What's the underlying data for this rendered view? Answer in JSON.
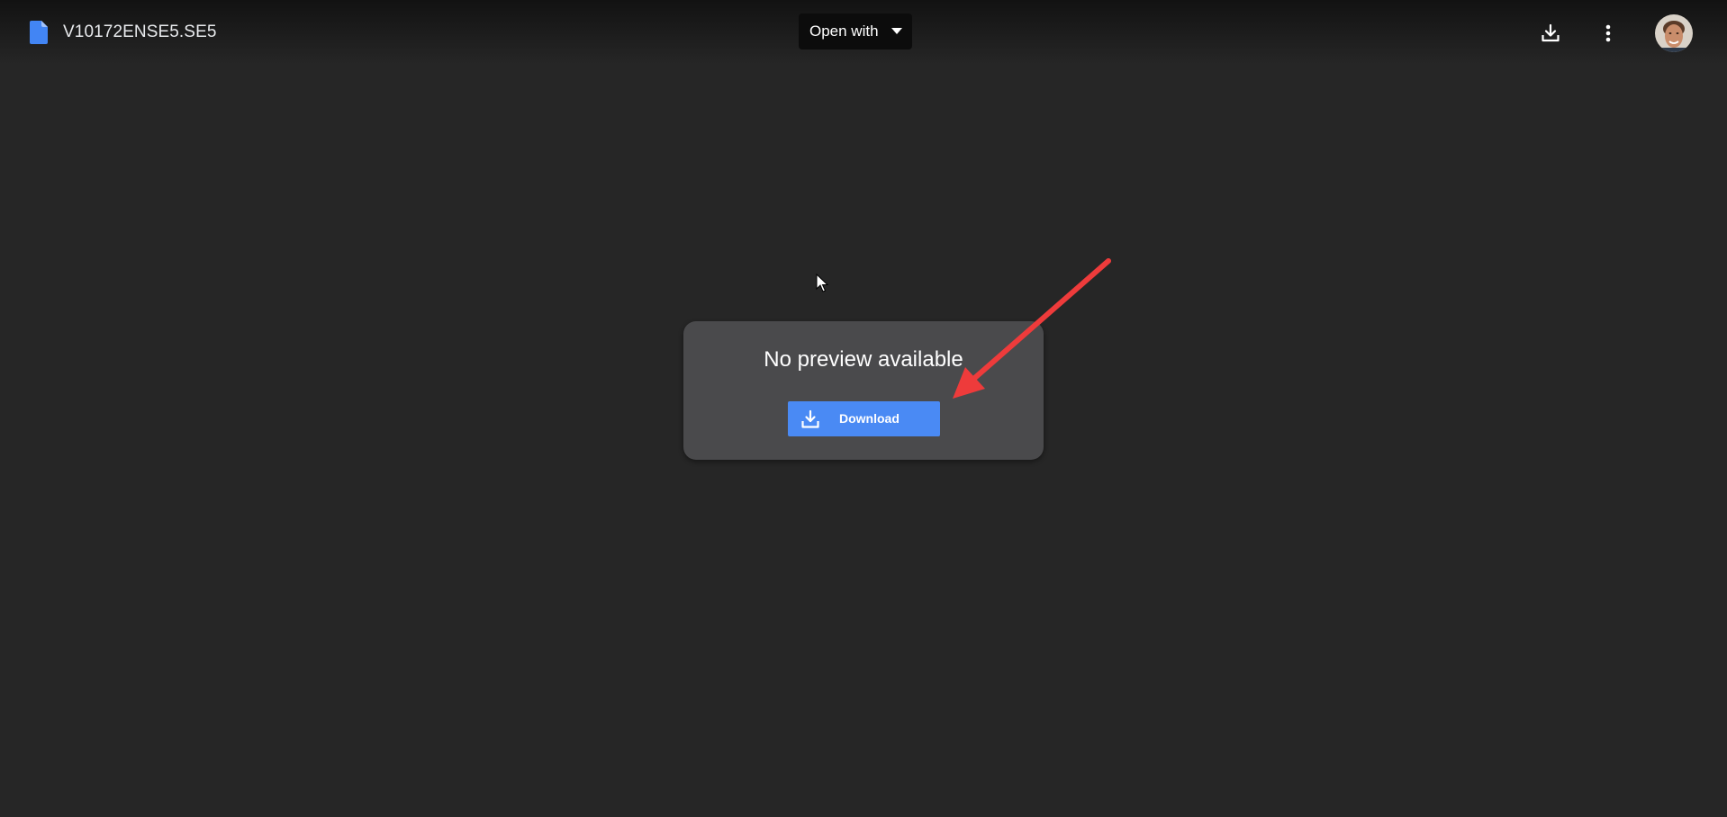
{
  "header": {
    "file_name": "V10172ENSE5.SE5",
    "open_with_label": "Open with",
    "file_icon": "document-icon",
    "download_icon": "download-icon",
    "more_icon": "more-vert-icon",
    "avatar": "user-avatar"
  },
  "preview": {
    "message": "No preview available",
    "download_label": "Download",
    "download_icon": "download-icon"
  },
  "colors": {
    "background": "#262626",
    "accent_blue": "#4a8af4",
    "file_icon_blue": "#4285f4",
    "card_background": "#4a4a4c",
    "annotation_red": "#ee3b3b"
  }
}
